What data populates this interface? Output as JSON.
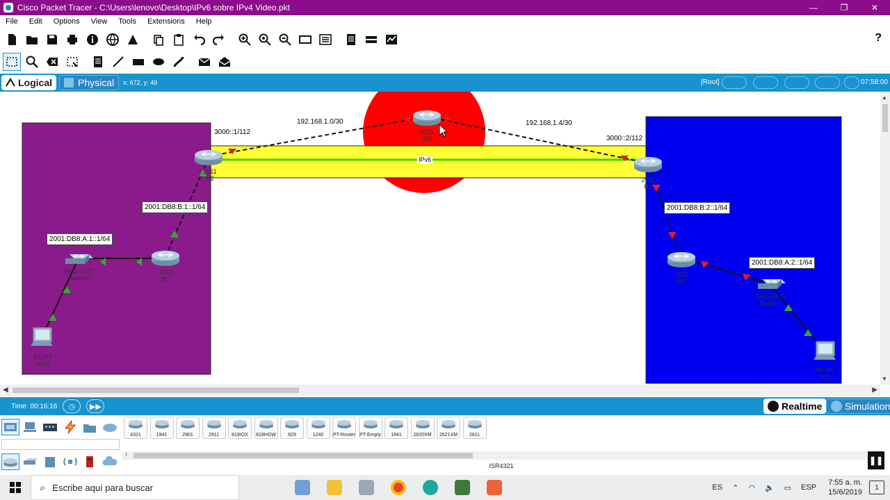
{
  "window": {
    "title": "Cisco Packet Tracer - C:\\Users\\lenovo\\Desktop\\IPv6 sobre IPv4 Video.pkt",
    "minimize": "—",
    "maximize": "❐",
    "close": "✕"
  },
  "menu": [
    "File",
    "Edit",
    "Options",
    "View",
    "Tools",
    "Extensions",
    "Help"
  ],
  "help_button": "?",
  "modebar": {
    "logical": "Logical",
    "physical": "Physical",
    "coords": "x: 672, y: 49",
    "root": "[Root]",
    "clock": "07:58:00"
  },
  "topology": {
    "network_labels": {
      "isp_left": "192.168.1.0/30",
      "isp_right": "192.168.1.4/30",
      "r2_tunnel": "3000::1/112",
      "r3_tunnel": "3000::2/112",
      "tunnel": "IPv6"
    },
    "address_labels": {
      "r1_r2": "2001:DB8:B:1::1/64",
      "lan_a1": "2001:DB8:A:1::1/64",
      "r3_r4": "2001:DB8:B:2::1/64",
      "lan_a2": "2001:DB8:A:2::1/64"
    },
    "devices": {
      "isp": {
        "model": "2911",
        "name": "ISP"
      },
      "r2": {
        "model": "2911",
        "name": "R2"
      },
      "r3": {
        "model": "2911",
        "name": "R3"
      },
      "r1": {
        "model": "2911",
        "name": "R1"
      },
      "r4": {
        "model": "2911",
        "name": "R4"
      },
      "switch0": {
        "model": "2960-24TT",
        "name": "Switch0"
      },
      "switch1": {
        "model": "2960-24TT",
        "name": "Switch1"
      },
      "pc0": {
        "model": "PC-PT",
        "name": "PC0"
      },
      "pc1": {
        "model": "PC-PT",
        "name": "PC1"
      }
    },
    "colors": {
      "left_area": "#8b1a8b",
      "right_area": "#0000f0",
      "isp_area": "#ff0000",
      "tunnel_area": "#ffff33",
      "tunnel_link": "#33dd00",
      "link_up": "#33aa33",
      "link_down": "#dd2222"
    }
  },
  "timebar": {
    "time": "Time: 00:16:16",
    "realtime": "Realtime",
    "simulation": "Simulation"
  },
  "device_panel": {
    "devices": [
      "4321",
      "1941",
      "2901",
      "2911",
      "819IOX",
      "819HGW",
      "829",
      "1240",
      "PT-Router",
      "PT-Empty",
      "1841",
      "2620XM",
      "2621XM",
      "2811"
    ],
    "selected_model": "ISR4321"
  },
  "taskbar": {
    "search_placeholder": "Escribe aquí para buscar",
    "lang": "ES",
    "keyboard": "ESP",
    "time": "7:55 a. m.",
    "date": "15/6/2019",
    "notifications": "1"
  }
}
